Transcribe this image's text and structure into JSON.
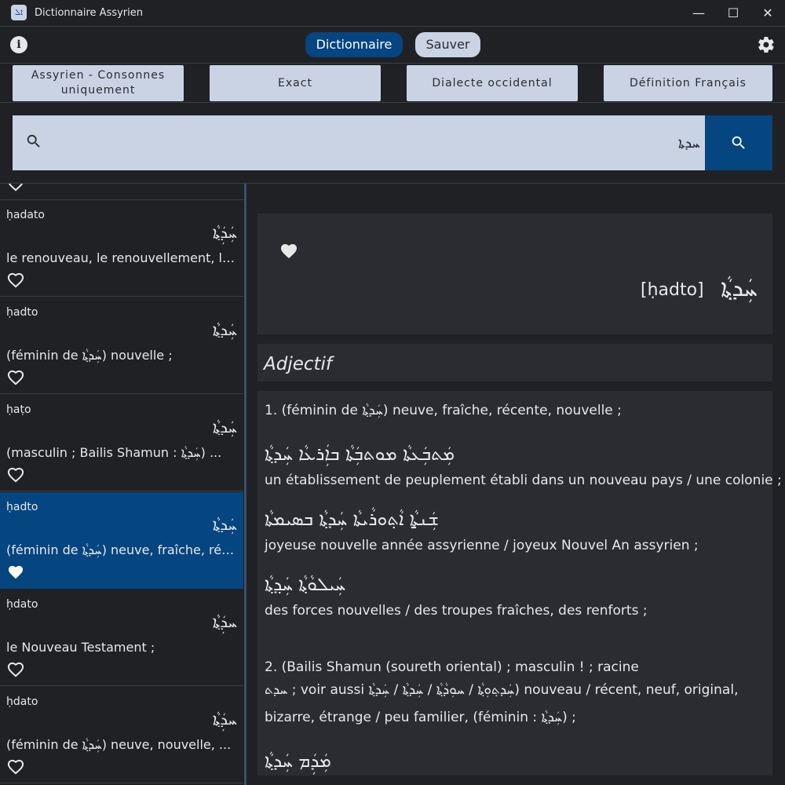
{
  "window": {
    "title": "Dictionnaire Assyrien",
    "app_icon_glyph": "ܐܠ",
    "minimize": "—",
    "maximize": "☐",
    "close": "✕"
  },
  "topbar": {
    "info_label": "i",
    "tab_dictionary": "Dictionnaire",
    "tab_saved": "Sauver",
    "settings_icon": "gear-icon"
  },
  "filters": [
    {
      "label": "Assyrien - Consonnes uniquement"
    },
    {
      "label": "Exact"
    },
    {
      "label": "Dialecte occidental"
    },
    {
      "label": "Définition Français"
    }
  ],
  "search": {
    "value": "ܚܕܬܐ",
    "icon_left": "search-icon",
    "icon_button": "search-icon"
  },
  "results": [
    {
      "translit": "ḥadato",
      "syriac": "ܚܲܕܲܬ݂ܵܐ",
      "definition": "le renouveau, le renouvellement, la ...",
      "favorite": false,
      "selected": false
    },
    {
      "translit": "ḥadto",
      "syriac": "ܚܲܕܬ݂ܵܐ",
      "definition": "(féminin de ܚܲܕܬ݂ܵܐ) nouvelle ;",
      "favorite": false,
      "selected": false
    },
    {
      "translit": "ḥaṭo",
      "syriac": "ܚܲܕܬ݂ܵܐ",
      "definition": "(masculin ; Bailis Shamun : ܚܲܕܬ݂ܵܐ) ...",
      "favorite": false,
      "selected": false
    },
    {
      "translit": "ḥadto",
      "syriac": "ܚܲܕܬ݂ܵܐ",
      "definition": "(féminin de ܚܲܕܬ݂ܵܐ) neuve, fraîche, récent...",
      "favorite": true,
      "selected": true
    },
    {
      "translit": "ḥdato",
      "syriac": "ܚܕܲܬ݂ܵܐ",
      "definition": "le Nouveau Testament ;",
      "favorite": false,
      "selected": false
    },
    {
      "translit": "ḥdato",
      "syriac": "ܚܕܲܬ݂ܵܐ",
      "definition": "(féminin de ܚܲܕܬ݂ܵܐ) neuve, nouvelle, ...",
      "favorite": false,
      "selected": false
    }
  ],
  "entry": {
    "transliteration": "[ḥadto]",
    "syriac": "ܚܲܕܬ݂ܵܐ",
    "part_of_speech": "Adjectif",
    "lines": [
      "1. (féminin de ܚܲܕܬ݂ܵܐ) neuve, fraîche, récente, nouvelle ;",
      "ܡܲܬܒܲܥܬܵܐ ܡܘܬܒܲܬܵܐ ܒܐܲܪܥܵܐ ܚܲܕܬ݂ܵܐ",
      "un établissement de peuplement établi dans un nouveau pays / une colonie ;",
      "ܫܲܢ̱ܬܵܐ ܐܵܬ݂ܘܪܵܝܬܵܐ ܚܲܕܬ݂ܵܐ ܒܣܝܡܬܵܐ",
      "joyeuse nouvelle année assyrienne / joyeux Nouvel An assyrien ;",
      "ܚܲܝܠܘܵܬ݂ܵܐ ܚܲܕ݂ܬ݂ܵܐ",
      "des forces nouvelles / des troupes fraîches, des renforts ;",
      "2. (Bailis Shamun (soureth oriental) ; masculin ! ; racine",
      "ܚܕܬ ; voir aussi ܚܲܕܬ݂ܘܼܬ݂ܵܐ / ܚܘܼܕܵܬ݂ܵܐ / ܚܲܕܬ݂ܵܐ / ܚܲܕܬ݂ܵܐ) nouveau / récent, neuf, original,",
      "bizarre, étrange / peu familier, (féminin : ܚܲܕܬ݂ܵܐ) ;",
      "ܡܲܕܲܡ ܚܲܕܬ݂ܵܐ"
    ]
  }
}
